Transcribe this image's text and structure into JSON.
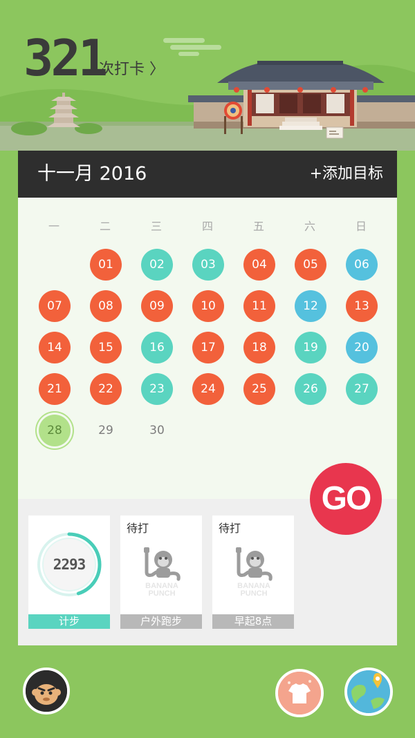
{
  "header": {
    "checkin_count": "321",
    "checkin_link": "次打卡 〉"
  },
  "calendar": {
    "month_title": "十一月 2016",
    "add_goal_label": "+添加目标",
    "weekdays": [
      "一",
      "二",
      "三",
      "四",
      "五",
      "六",
      "日"
    ],
    "days": [
      {
        "label": "01",
        "status": "red"
      },
      {
        "label": "02",
        "status": "teal"
      },
      {
        "label": "03",
        "status": "teal"
      },
      {
        "label": "04",
        "status": "red"
      },
      {
        "label": "05",
        "status": "red"
      },
      {
        "label": "06",
        "status": "blue"
      },
      {
        "label": "07",
        "status": "red"
      },
      {
        "label": "08",
        "status": "red"
      },
      {
        "label": "09",
        "status": "red"
      },
      {
        "label": "10",
        "status": "red"
      },
      {
        "label": "11",
        "status": "red"
      },
      {
        "label": "12",
        "status": "blue"
      },
      {
        "label": "13",
        "status": "red"
      },
      {
        "label": "14",
        "status": "red"
      },
      {
        "label": "15",
        "status": "red"
      },
      {
        "label": "16",
        "status": "teal"
      },
      {
        "label": "17",
        "status": "red"
      },
      {
        "label": "18",
        "status": "red"
      },
      {
        "label": "19",
        "status": "teal"
      },
      {
        "label": "20",
        "status": "blue"
      },
      {
        "label": "21",
        "status": "red"
      },
      {
        "label": "22",
        "status": "red"
      },
      {
        "label": "23",
        "status": "teal"
      },
      {
        "label": "24",
        "status": "red"
      },
      {
        "label": "25",
        "status": "red"
      },
      {
        "label": "26",
        "status": "teal"
      },
      {
        "label": "27",
        "status": "teal"
      },
      {
        "label": "28",
        "status": "today"
      },
      {
        "label": "29",
        "status": "plain"
      },
      {
        "label": "30",
        "status": "plain"
      }
    ],
    "first_weekday_index": 1
  },
  "go_button": {
    "label": "GO"
  },
  "goals": [
    {
      "label": "计步",
      "value": "2293",
      "progress": 0.45,
      "active": true
    },
    {
      "label": "户外跑步",
      "status": "待打",
      "logo_text": "BANANA PUNCH",
      "active": false
    },
    {
      "label": "早起8点",
      "status": "待打",
      "logo_text": "BANANA PUNCH",
      "active": false
    }
  ],
  "colors": {
    "background": "#8cc65e",
    "red": "#f2613b",
    "teal": "#5ad4c0",
    "blue": "#55c1de",
    "go": "#e8364e"
  },
  "icons": {
    "avatar": "monkey-avatar-icon",
    "shop": "tshirt-icon",
    "map": "globe-location-icon"
  }
}
